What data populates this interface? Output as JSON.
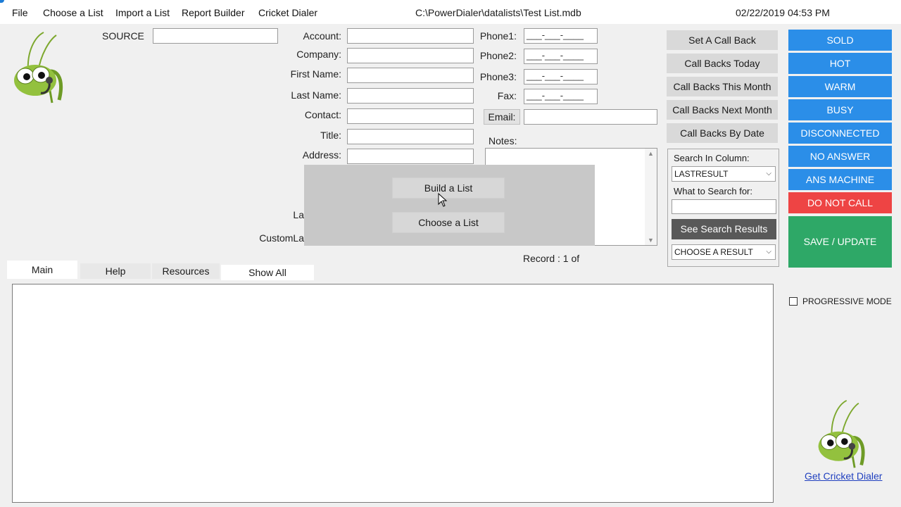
{
  "menu": {
    "items": [
      "File",
      "Choose a List",
      "Import a List",
      "Report Builder",
      "Cricket Dialer"
    ],
    "db_path": "C:\\PowerDialer\\datalists\\Test List.mdb",
    "datetime": "02/22/2019 04:53 PM"
  },
  "source_label": "SOURCE",
  "fields": {
    "account": "Account:",
    "company": "Company:",
    "first_name": "First Name:",
    "last_name": "Last Name:",
    "contact": "Contact:",
    "title": "Title:",
    "address": "Address:",
    "la_partial": "La",
    "customla_partial": "CustomLa"
  },
  "phones": {
    "phone1": "Phone1:",
    "phone2": "Phone2:",
    "phone3": "Phone3:",
    "fax": "Fax:",
    "mask": "___-___-____"
  },
  "email_button": "Email:",
  "notes_label": "Notes:",
  "record_label": "Record : 1 of",
  "overlay": {
    "build": "Build a List",
    "choose": "Choose a List"
  },
  "callback_buttons": [
    "Set A Call Back",
    "Call Backs Today",
    "Call Backs This Month",
    "Call Backs Next Month",
    "Call Backs By Date"
  ],
  "search": {
    "column_label": "Search In Column:",
    "column_value": "LASTRESULT",
    "what_label": "What to Search for:",
    "see_results": "See Search Results",
    "result_value": "CHOOSE A RESULT"
  },
  "status_buttons": [
    {
      "label": "SOLD",
      "color": "#2b8ee8"
    },
    {
      "label": "HOT",
      "color": "#2b8ee8"
    },
    {
      "label": "WARM",
      "color": "#2b8ee8"
    },
    {
      "label": "BUSY",
      "color": "#2b8ee8"
    },
    {
      "label": "DISCONNECTED",
      "color": "#2b8ee8"
    },
    {
      "label": "NO ANSWER",
      "color": "#2b8ee8"
    },
    {
      "label": "ANS MACHINE",
      "color": "#2b8ee8"
    },
    {
      "label": "DO NOT CALL",
      "color": "#ee4444"
    }
  ],
  "save_update": "SAVE / UPDATE",
  "tabs": [
    "Main",
    "Help",
    "Resources",
    "Show All"
  ],
  "progressive_mode": "PROGRESSIVE MODE",
  "get_cricket": "Get Cricket Dialer",
  "colors": {
    "accent_blue": "#2b8ee8",
    "danger_red": "#ee4444",
    "save_green": "#2ea867",
    "search_dark": "#595959"
  }
}
